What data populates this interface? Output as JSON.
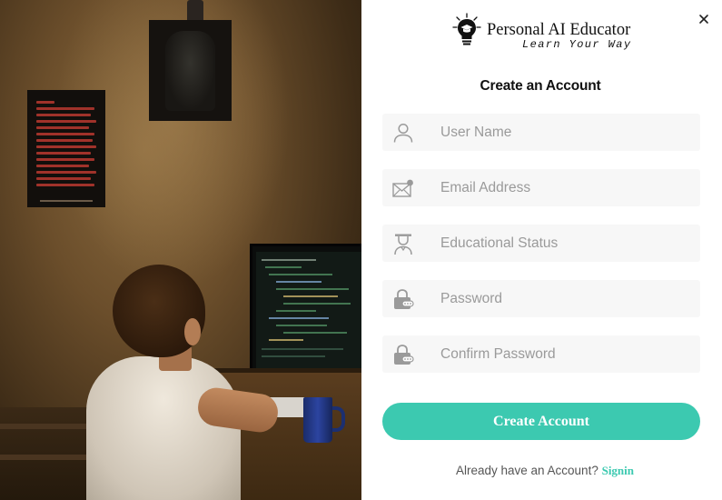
{
  "brand": {
    "name": "Personal AI Educator",
    "tagline": "Learn Your Way",
    "accent_color": "#3cc9b0"
  },
  "form": {
    "title": "Create an Account",
    "fields": [
      {
        "icon": "user-icon",
        "placeholder": "User Name",
        "value": ""
      },
      {
        "icon": "envelope-icon",
        "placeholder": "Email Address",
        "value": ""
      },
      {
        "icon": "graduate-icon",
        "placeholder": "Educational Status",
        "value": ""
      },
      {
        "icon": "lock-icon",
        "placeholder": "Password",
        "value": ""
      },
      {
        "icon": "lock-icon",
        "placeholder": "Confirm Password",
        "value": ""
      }
    ],
    "submit_label": "Create Account"
  },
  "footer": {
    "prompt": "Already have an Account?",
    "signin_label": "Signin"
  },
  "dialog": {
    "close_icon": "close-icon"
  }
}
